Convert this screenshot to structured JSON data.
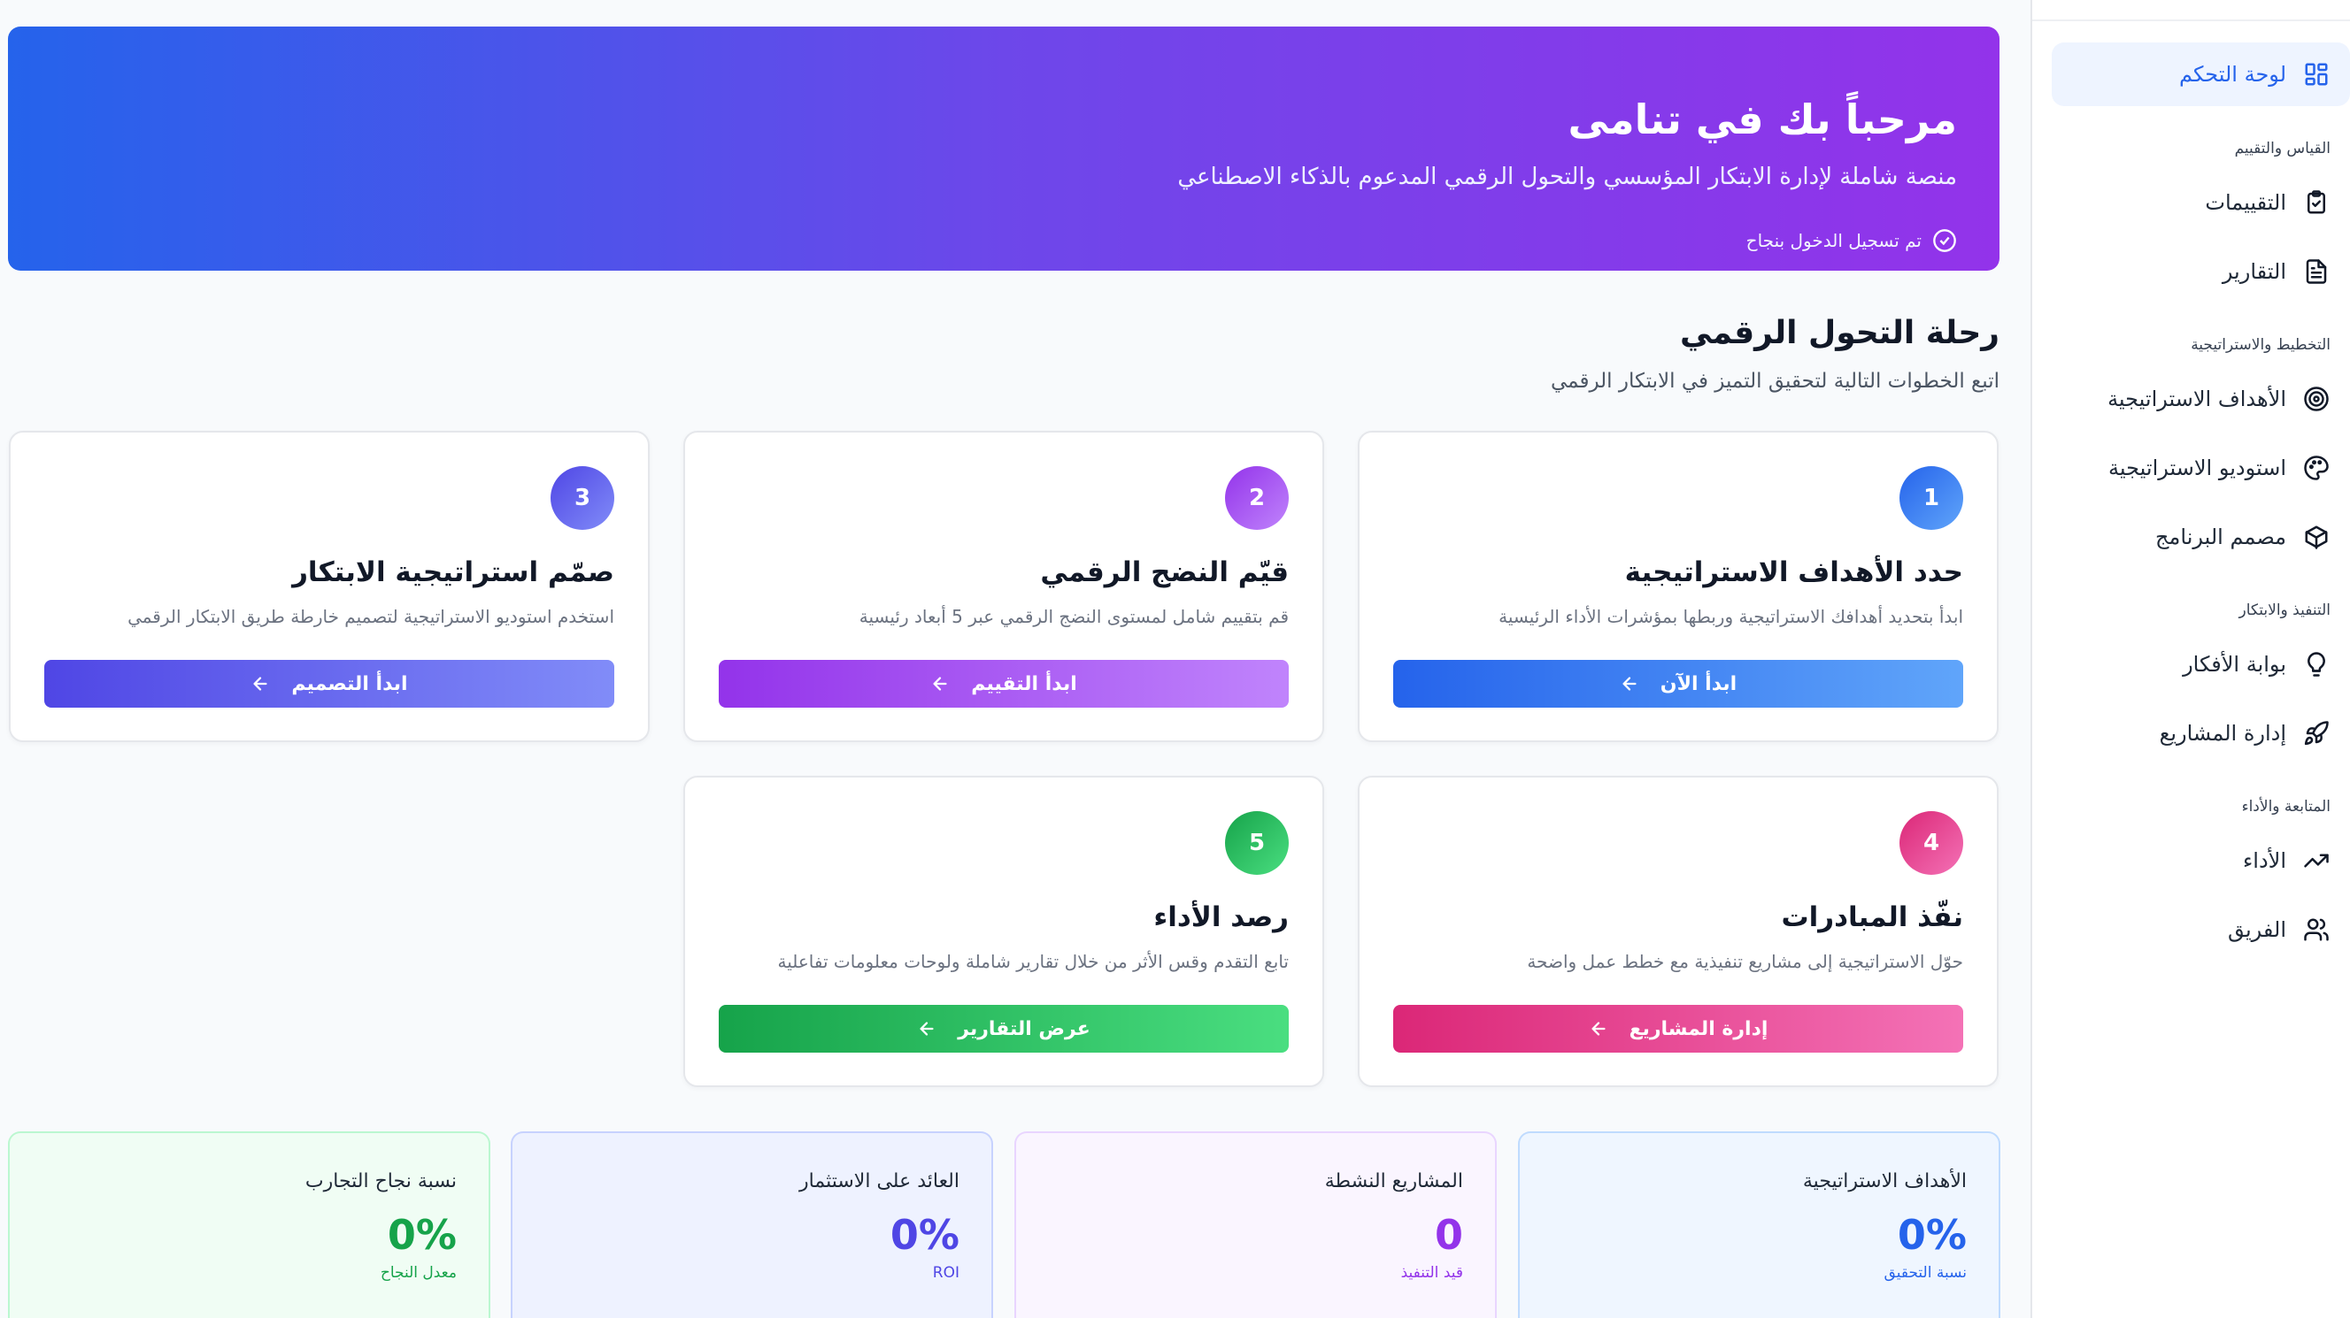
{
  "sidebar": {
    "dashboard_label": "لوحة التحكم",
    "sections": {
      "measurement": "القياس والتقييم",
      "planning": "التخطيط والاستراتيجية",
      "execution": "التنفيذ والابتكار",
      "monitoring": "المتابعة والأداء"
    },
    "items": {
      "assessments": "التقييمات",
      "reports": "التقارير",
      "strategic_goals": "الأهداف الاستراتيجية",
      "strategy_studio": "استوديو الاستراتيجية",
      "program_designer": "مصمم البرنامج",
      "ideas_portal": "بوابة الأفكار",
      "project_management": "إدارة المشاريع",
      "performance": "الأداء",
      "team": "الفريق"
    },
    "icons": {
      "dashboard": "grid-icon",
      "assessments": "clipboard-check-icon",
      "reports": "file-text-icon",
      "strategic_goals": "target-icon",
      "strategy_studio": "palette-icon",
      "program_designer": "box-icon",
      "ideas_portal": "lightbulb-icon",
      "project_management": "rocket-icon",
      "performance": "trending-up-icon",
      "team": "users-icon"
    }
  },
  "hero": {
    "title": "مرحباً بك في تنامى",
    "subtitle": "منصة شاملة لإدارة الابتكار المؤسسي والتحول الرقمي المدعوم بالذكاء الاصطناعي",
    "status": "تم تسجيل الدخول بنجاح"
  },
  "journey": {
    "title": "رحلة التحول الرقمي",
    "subtitle": "اتبع الخطوات التالية لتحقيق التميز في الابتكار الرقمي",
    "steps": [
      {
        "number": "1",
        "title": "حدد الأهداف الاستراتيجية",
        "description": "ابدأ بتحديد أهدافك الاستراتيجية وربطها بمؤشرات الأداء الرئيسية",
        "button": "ابدأ الآن",
        "color": "#2563eb"
      },
      {
        "number": "2",
        "title": "قيّم النضج الرقمي",
        "description": "قم بتقييم شامل لمستوى النضج الرقمي عبر 5 أبعاد رئيسية",
        "button": "ابدأ التقييم",
        "color": "#9333ea"
      },
      {
        "number": "3",
        "title": "صمّم استراتيجية الابتكار",
        "description": "استخدم استوديو الاستراتيجية لتصميم خارطة طريق الابتكار الرقمي",
        "button": "ابدأ التصميم",
        "color": "#4f46e5"
      },
      {
        "number": "4",
        "title": "نفّذ المبادرات",
        "description": "حوّل الاستراتيجية إلى مشاريع تنفيذية مع خطط عمل واضحة",
        "button": "إدارة المشاريع",
        "color": "#db2777"
      },
      {
        "number": "5",
        "title": "رصد الأداء",
        "description": "تابع التقدم وقس الأثر من خلال تقارير شاملة ولوحات معلومات تفاعلية",
        "button": "عرض التقارير",
        "color": "#16a34a"
      }
    ]
  },
  "stats": [
    {
      "label": "الأهداف الاستراتيجية",
      "value": "0%",
      "note": "نسبة التحقيق",
      "color": "#2563eb"
    },
    {
      "label": "المشاريع النشطة",
      "value": "0",
      "note": "قيد التنفيذ",
      "color": "#9333ea"
    },
    {
      "label": "العائد على الاستثمار",
      "value": "0%",
      "note": "ROI",
      "color": "#4f46e5"
    },
    {
      "label": "نسبة نجاح التجارب",
      "value": "0%",
      "note": "معدل النجاح",
      "color": "#16a34a"
    }
  ]
}
